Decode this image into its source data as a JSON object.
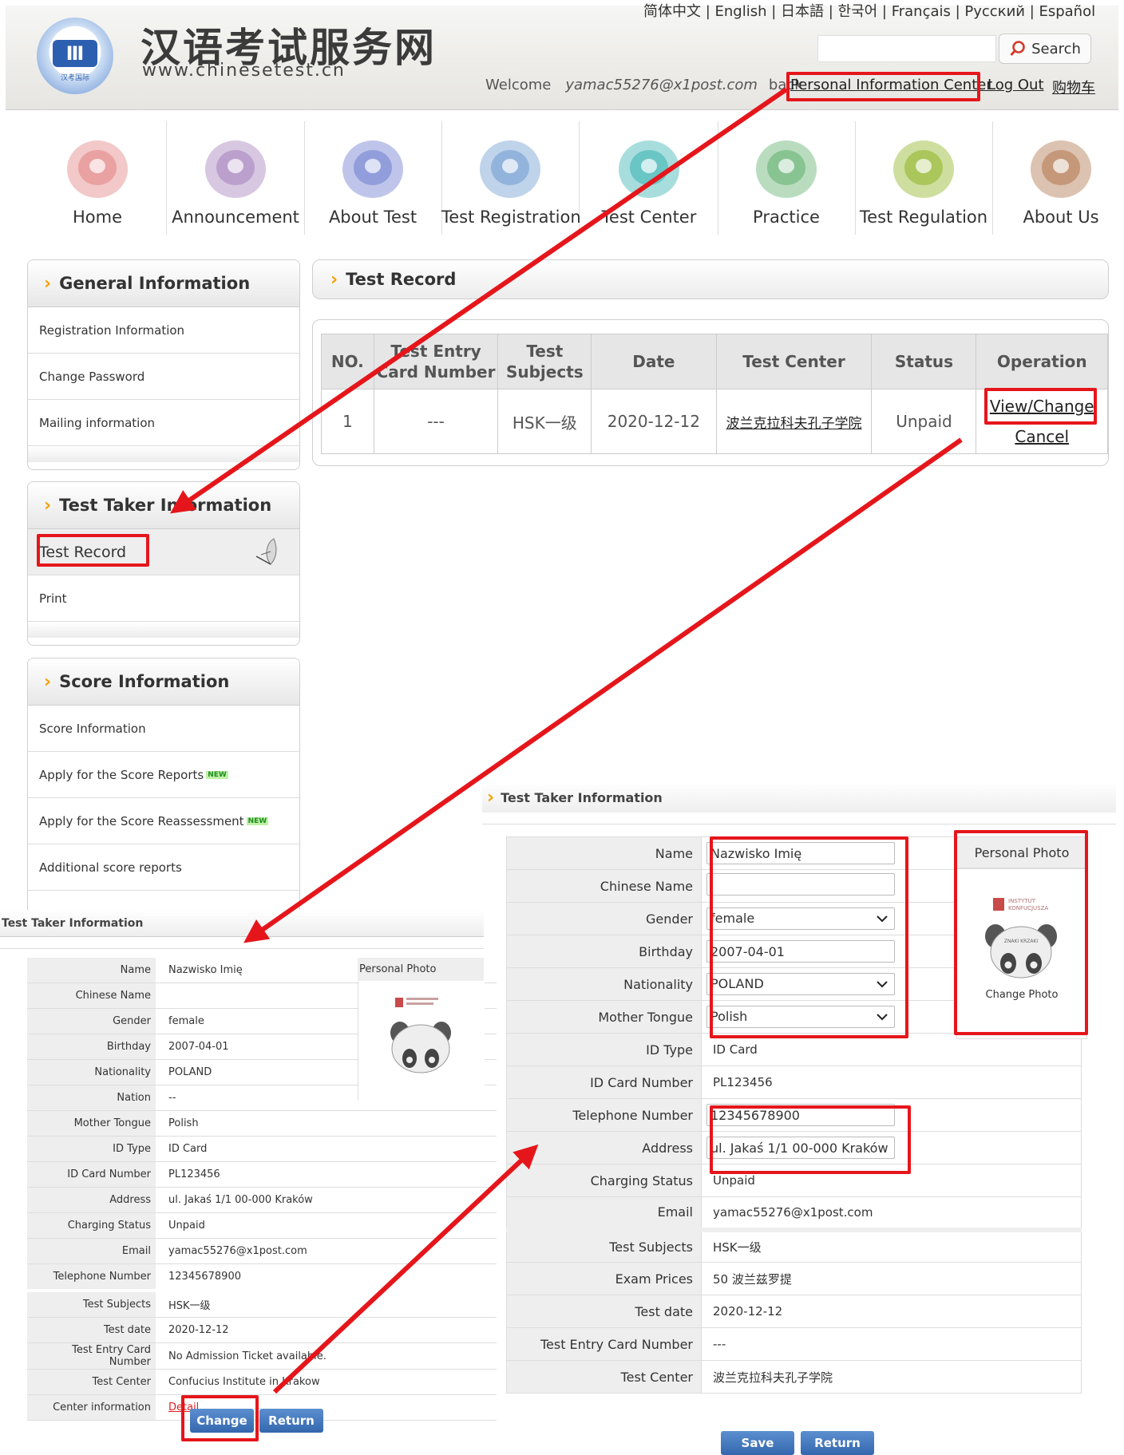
{
  "header": {
    "site_name_cn": "汉语考试服务网",
    "site_url": "www.chinesetest.cn",
    "logo_sub": "汉考国际",
    "languages": "简体中文 | English | 日本語 | 한국어 | Français | Русский | Español",
    "search_label": "Search",
    "welcome": "Welcome",
    "user_email": "yamac55276@x1post.com",
    "back": "back",
    "personal_center": "Personal Information Center",
    "logout": "Log Out",
    "cart": "购物车"
  },
  "nav": [
    {
      "label": "Home",
      "icon": "home-icon",
      "color": "#e79a9a"
    },
    {
      "label": "Announcement",
      "icon": "announcement-icon",
      "color": "#b699c9"
    },
    {
      "label": "About Test",
      "icon": "about-test-icon",
      "color": "#8a95d9"
    },
    {
      "label": "Test Registration",
      "icon": "registration-icon",
      "color": "#8aaed9"
    },
    {
      "label": "Test Center",
      "icon": "test-center-icon",
      "color": "#5fc1c1"
    },
    {
      "label": "Practice",
      "icon": "practice-icon",
      "color": "#7fbf8a"
    },
    {
      "label": "Test Regulation",
      "icon": "regulation-icon",
      "color": "#a5c24f"
    },
    {
      "label": "About Us",
      "icon": "about-us-icon",
      "color": "#c09070"
    }
  ],
  "sidebar": {
    "general": {
      "title": "General Information",
      "items": [
        "Registration Information",
        "Change Password",
        "Mailing information"
      ]
    },
    "test_taker": {
      "title": "Test Taker Information",
      "items": [
        "Test Record",
        "Print"
      ]
    },
    "score": {
      "title": "Score Information",
      "items": [
        "Score Information",
        "Apply for the Score Reports",
        "Apply for the Score Reassessment",
        "Additional score reports"
      ],
      "new_badge": "NEW"
    }
  },
  "record": {
    "title": "Test Record",
    "headers": [
      "NO.",
      "Test Entry Card Number",
      "Test Subjects",
      "Date",
      "Test Center",
      "Status",
      "Operation"
    ],
    "row": {
      "no": "1",
      "entry": "---",
      "subject": "HSK一级",
      "date": "2020-12-12",
      "center": "波兰克拉科夫孔子学院",
      "status": "Unpaid",
      "view_change": "View/Change",
      "cancel": "Cancel"
    }
  },
  "mini_form": {
    "title": "Test Taker Information",
    "photo_label": "Personal Photo",
    "rows": [
      {
        "k": "Name",
        "v": "Nazwisko Imię"
      },
      {
        "k": "Chinese Name",
        "v": ""
      },
      {
        "k": "Gender",
        "v": "female"
      },
      {
        "k": "Birthday",
        "v": "2007-04-01"
      },
      {
        "k": "Nationality",
        "v": "POLAND"
      },
      {
        "k": "Nation",
        "v": "--"
      },
      {
        "k": "Mother Tongue",
        "v": "Polish"
      },
      {
        "k": "ID Type",
        "v": "ID Card"
      },
      {
        "k": "ID Card Number",
        "v": "PL123456"
      },
      {
        "k": "Address",
        "v": "ul. Jakaś 1/1 00-000 Kraków"
      },
      {
        "k": "Charging Status",
        "v": "Unpaid"
      },
      {
        "k": "Email",
        "v": "yamac55276@x1post.com"
      },
      {
        "k": "Telephone Number",
        "v": "12345678900"
      },
      {
        "k": "Test Subjects",
        "v": "HSK一级"
      },
      {
        "k": "Test date",
        "v": "2020-12-12"
      },
      {
        "k": "Test Entry Card Number",
        "v": "No Admission Ticket available."
      },
      {
        "k": "Test Center",
        "v": "Confucius Institute in Krakow"
      },
      {
        "k": "Center information",
        "v": "Detail"
      }
    ],
    "change_btn": "Change",
    "return_btn": "Return"
  },
  "big_form": {
    "title": "Test Taker Information",
    "photo_label": "Personal Photo",
    "change_photo": "Change Photo",
    "photo_caption_1": "INSTYTUT",
    "photo_caption_2": "KONFUCJUSZA",
    "photo_caption_3": "ZNAKI KRZAKI",
    "rows": [
      {
        "k": "Name",
        "v": "Nazwisko Imię",
        "type": "input"
      },
      {
        "k": "Chinese Name",
        "v": "",
        "type": "input"
      },
      {
        "k": "Gender",
        "v": "female",
        "type": "select"
      },
      {
        "k": "Birthday",
        "v": "2007-04-01",
        "type": "input"
      },
      {
        "k": "Nationality",
        "v": "POLAND",
        "type": "select"
      },
      {
        "k": "Mother Tongue",
        "v": "Polish",
        "type": "select"
      },
      {
        "k": "ID Type",
        "v": "ID Card",
        "type": "text"
      },
      {
        "k": "ID Card Number",
        "v": "PL123456",
        "type": "text"
      },
      {
        "k": "Telephone Number",
        "v": "12345678900",
        "type": "input"
      },
      {
        "k": "Address",
        "v": "ul. Jakaś 1/1 00-000 Kraków",
        "type": "input"
      },
      {
        "k": "Charging Status",
        "v": "Unpaid",
        "type": "text"
      },
      {
        "k": "Email",
        "v": "yamac55276@x1post.com",
        "type": "text"
      },
      {
        "k": "Test Subjects",
        "v": "HSK一级",
        "type": "text"
      },
      {
        "k": "Exam Prices",
        "v": "50  波兰兹罗提",
        "type": "text"
      },
      {
        "k": "Test date",
        "v": "2020-12-12",
        "type": "text"
      },
      {
        "k": "Test Entry Card Number",
        "v": "---",
        "type": "text"
      },
      {
        "k": "Test Center",
        "v": "波兰克拉科夫孔子学院",
        "type": "text"
      }
    ],
    "save_btn": "Save",
    "return_btn": "Return"
  },
  "colors": {
    "highlight": "#e5161b",
    "button": "#3467ad",
    "chevron": "#f2a100"
  }
}
